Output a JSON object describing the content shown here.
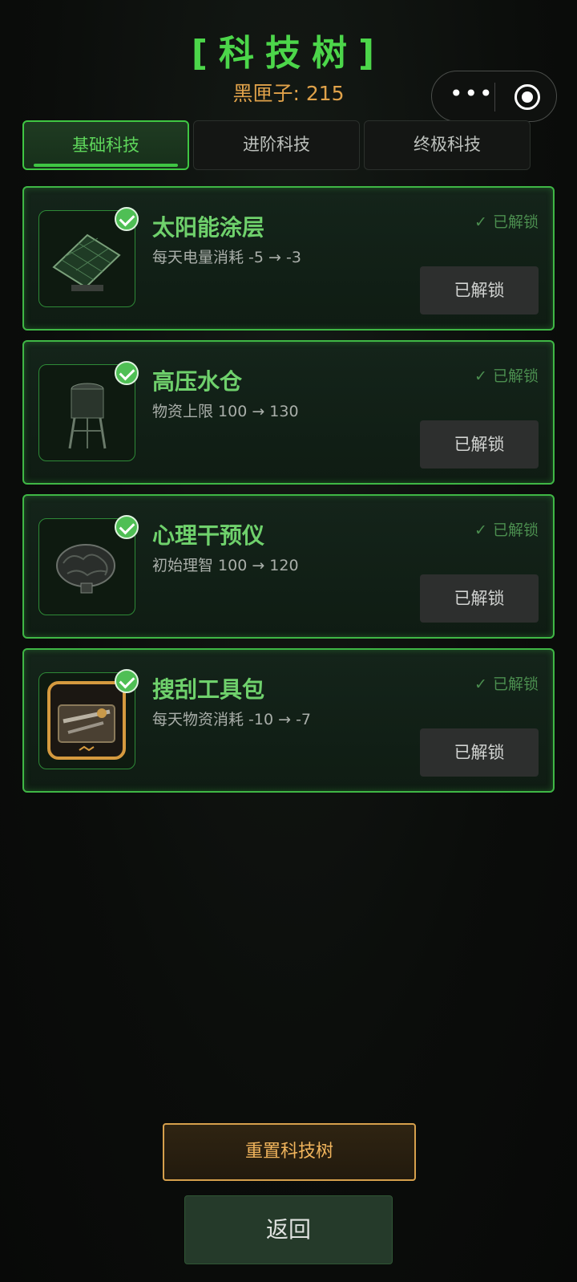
{
  "title": "[科技树]",
  "currency": {
    "label": "黑匣子: 215"
  },
  "capsule": {
    "more_icon": "more-dots-icon",
    "close_icon": "target-icon"
  },
  "tabs": [
    {
      "label": "基础科技",
      "active": true
    },
    {
      "label": "进阶科技",
      "active": false
    },
    {
      "label": "终极科技",
      "active": false
    }
  ],
  "techs": [
    {
      "name": "太阳能涂层",
      "desc": "每天电量消耗 -5 → -3",
      "status": "已解锁",
      "button": "已解锁",
      "icon": "solar-panel-icon"
    },
    {
      "name": "高压水仓",
      "desc": "物资上限 100 → 130",
      "status": "已解锁",
      "button": "已解锁",
      "icon": "water-tower-icon"
    },
    {
      "name": "心理干预仪",
      "desc": "初始理智 100 → 120",
      "status": "已解锁",
      "button": "已解锁",
      "icon": "brain-device-icon"
    },
    {
      "name": "搜刮工具包",
      "desc": "每天物资消耗 -10 → -7",
      "status": "已解锁",
      "button": "已解锁",
      "icon": "toolbox-icon"
    }
  ],
  "actions": {
    "reset": "重置科技树",
    "back": "返回"
  },
  "colors": {
    "accent": "#4cd64a",
    "gold": "#e0a24a",
    "card_border": "#3fb745"
  }
}
